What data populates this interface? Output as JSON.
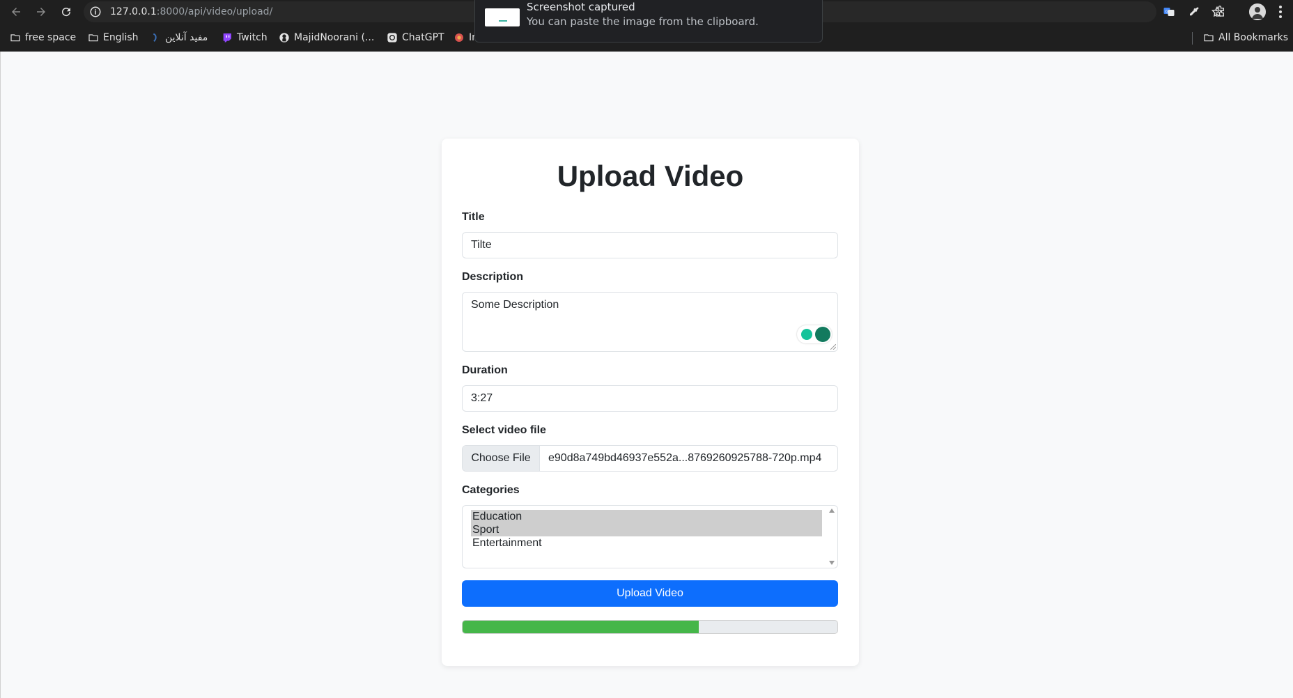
{
  "browser": {
    "url_host": "127.0.0.1",
    "url_path": ":8000/api/video/upload/",
    "bookmarks": [
      {
        "label": "free space",
        "icon": "folder-icon"
      },
      {
        "label": "English",
        "icon": "folder-icon"
      },
      {
        "label": "مفید آنلاین",
        "icon": "site-icon"
      },
      {
        "label": "Twitch",
        "icon": "twitch-icon"
      },
      {
        "label": "MajidNoorani (...",
        "icon": "github-icon"
      },
      {
        "label": "ChatGPT",
        "icon": "chatgpt-icon"
      },
      {
        "label": "In",
        "icon": "site-icon"
      }
    ],
    "all_bookmarks": "All Bookmarks"
  },
  "toast": {
    "title": "Screenshot captured",
    "message": "You can paste the image from the clipboard."
  },
  "form": {
    "heading": "Upload Video",
    "title_label": "Title",
    "title_value": "Tilte",
    "description_label": "Description",
    "description_value": "Some Description",
    "duration_label": "Duration",
    "duration_value": "3:27",
    "file_label": "Select video file",
    "file_button": "Choose File",
    "file_name": "e90d8a749bd46937e552a...8769260925788-720p.mp4",
    "categories_label": "Categories",
    "categories": [
      {
        "label": "Education",
        "selected": true
      },
      {
        "label": "Sport",
        "selected": true
      },
      {
        "label": "Entertainment",
        "selected": false
      }
    ],
    "submit_label": "Upload Video",
    "upload_progress_percent": 63
  },
  "colors": {
    "primary": "#0d6efd",
    "progress": "#45b649"
  }
}
